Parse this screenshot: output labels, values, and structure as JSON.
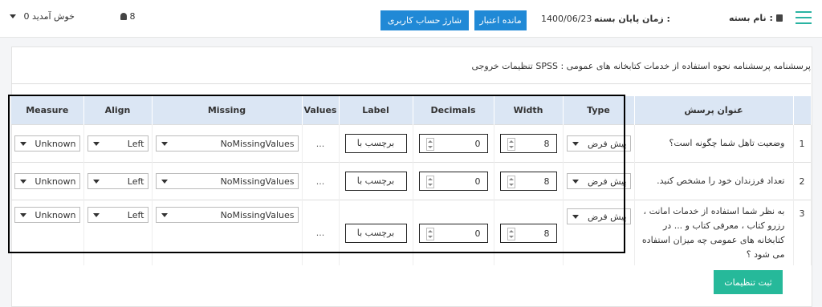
{
  "header": {
    "package_label": "نام بسته :",
    "end_time_label": "زمان پایان بسته :",
    "end_date": "1400/06/23",
    "credit_button": "مانده اعتبار",
    "recharge_button": "شارژ حساب کاربری",
    "user_count": "8",
    "welcome": "خوش آمدید",
    "welcome_count": "0"
  },
  "page": {
    "title": "تنظیمات خروجی SPSS : پرسشنامه پرسشنامه نحوه استفاده از خدمات کتابخانه های عمومی",
    "save_button": "ثبت تنظیمات"
  },
  "table": {
    "columns": {
      "question": "عنوان پرسش",
      "type": "Type",
      "width": "Width",
      "decimals": "Decimals",
      "label": "Label",
      "values": "Values",
      "missing": "Missing",
      "align": "Align",
      "measure": "Measure"
    },
    "rows": [
      {
        "num": "1",
        "question": "وضعیت تاهل شما چگونه است؟",
        "type": "پیش فرض",
        "width": "8",
        "decimals": "0",
        "label": "برچسب با",
        "values": "...",
        "missing": "NoMissingValues",
        "align": "Left",
        "measure": "Unknown"
      },
      {
        "num": "2",
        "question": "تعداد فرزندان خود را مشخص کنید.",
        "type": "پیش فرض",
        "width": "8",
        "decimals": "0",
        "label": "برچسب با",
        "values": "...",
        "missing": "NoMissingValues",
        "align": "Left",
        "measure": "Unknown"
      },
      {
        "num": "3",
        "question": "به نظر شما استفاده از خدمات امانت ، رزرو کتاب ، معرفی کتاب و ... در کتابخانه های عمومی چه میزان استفاده می شود ؟",
        "type": "پیش فرض",
        "width": "8",
        "decimals": "0",
        "label": "برچسب با",
        "values": "...",
        "missing": "NoMissingValues",
        "align": "Left",
        "measure": "Unknown"
      }
    ]
  },
  "icons": {
    "menu": "hamburger-icon",
    "book": "book-icon",
    "user": "user-icon",
    "caret": "caret-down-icon"
  },
  "colors": {
    "primary": "#2089d6",
    "success": "#26b99a",
    "accent": "#2ab3a2",
    "header_bg": "#dbe6f4"
  }
}
